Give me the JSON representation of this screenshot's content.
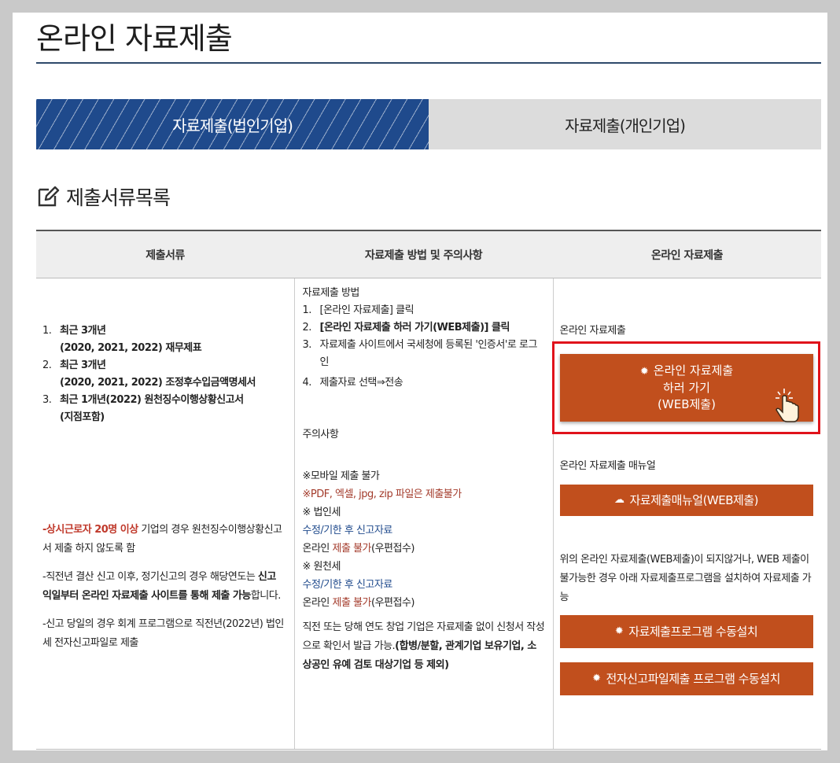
{
  "page_title": "온라인 자료제출",
  "tabs": [
    {
      "label": "자료제출(법인기업)",
      "active": true
    },
    {
      "label": "자료제출(개인기업)",
      "active": false
    }
  ],
  "section_title": "제출서류목록",
  "table_headers": [
    "제출서류",
    "자료제출 방법 및 주의사항",
    "온라인 자료제출"
  ],
  "documents": [
    {
      "num": "1.",
      "line1": "최근 3개년",
      "line2": "(2020, 2021, 2022) 재무제표"
    },
    {
      "num": "2.",
      "line1": "최근 3개년",
      "line2": "(2020, 2021, 2022) 조정후수입금액명세서"
    },
    {
      "num": "3.",
      "line1": "최근 1개년(2022) 원천징수이행상황신고서",
      "line2": "(지점포함)"
    }
  ],
  "notes": {
    "note1_red": "-상시근로자 20명 이상",
    "note1_rest": " 기업의 경우 원천징수이행상황신고서 제출 하지 않도록 함",
    "note2_a": "-직전년 결산 신고 이후, 정기신고의 경우 해당연도는 ",
    "note2_bold": "신고 익일부터 온라인 자료제출 사이트를 통해 제출 가능",
    "note2_c": "합니다.",
    "note3": "-신고 당일의 경우 회계 프로그램으로 직전년(2022년) 법인세 전자신고파일로 제출"
  },
  "method": {
    "title": "자료제출 방법",
    "steps": [
      {
        "num": "1.",
        "text": "[온라인 자료제출] 클릭",
        "bold": false
      },
      {
        "num": "2.",
        "text": "[온라인 자료제출 하러 가기(WEB제출)] 클릭",
        "bold": true
      },
      {
        "num": "3.",
        "text": "자료제출 사이트에서 국세청에 등록된 '인증서'로 로그인",
        "bold": false
      },
      {
        "num": "4.",
        "text": "제출자료 선택⇒전송",
        "bold": false
      }
    ]
  },
  "caution": {
    "title": "주의사항",
    "mobile": "※모바일 제출 불가",
    "file_types": "※PDF, 엑셀, jpg, zip 파일은 제출불가",
    "corp_tax": "※ 법인세",
    "corp_amend": "수정/기한 후 신고자료",
    "online_prefix": "온라인 ",
    "not_allowed": "제출 불가",
    "mail_suffix": "(우편접수)",
    "withholding": "※ 원천세",
    "withholding_amend": "수정/기한 후 신고자료",
    "final_a": "직전 또는 당해 연도 창업 기업은 자료제출 없이 신청서 작성으로 확인서 발급 가능.",
    "final_bold": "(합병/분할, 관계기업 보유기업, 소상공인 유예 검토 대상기업 등 제외)"
  },
  "online": {
    "label": "온라인 자료제출",
    "main_button_line1": "온라인 자료제출",
    "main_button_line2": "하러 가기",
    "main_button_line3": "(WEB제출)",
    "manual_label": "온라인 자료제출 매뉴얼",
    "manual_button": "자료제출매뉴얼(WEB제출)",
    "fallback_text": "위의 온라인 자료제출(WEB제출)이 되지않거나, WEB 제출이 불가능한 경우 아래 자료제출프로그램을 설치하여 자료제출 가능",
    "install_button": "자료제출프로그램 수동설치",
    "efile_button": "전자신고파일제출 프로그램 수동설치"
  },
  "colors": {
    "accent_blue": "#1f4a8c",
    "button_orange": "#c14f1d",
    "highlight_red": "#e0121b"
  }
}
